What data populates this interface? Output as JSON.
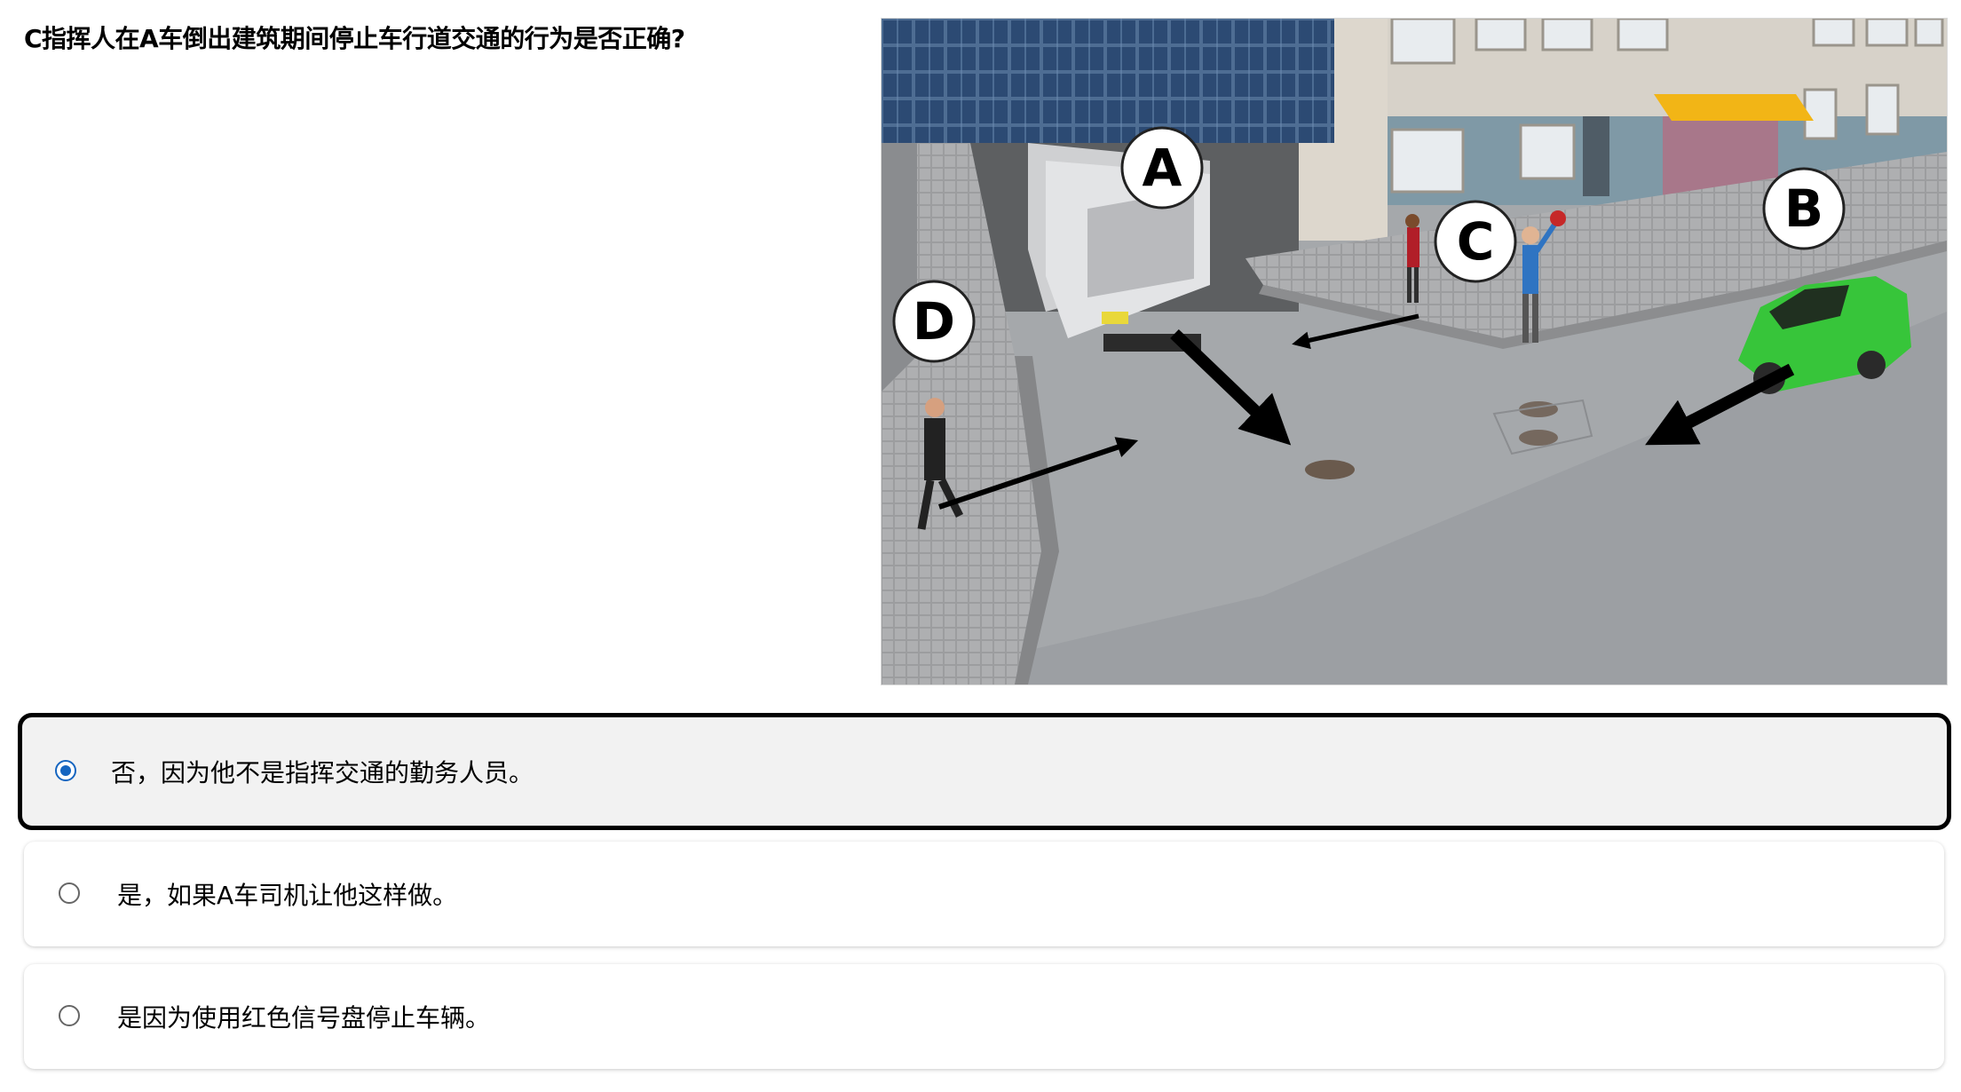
{
  "question": {
    "text": "C指挥人在A车倒出建筑期间停止车行道交通的行为是否正确?"
  },
  "illustration": {
    "markers": [
      "A",
      "B",
      "C",
      "D"
    ]
  },
  "answers": [
    {
      "label": "否，因为他不是指挥交通的勤务人员。",
      "selected": true
    },
    {
      "label": "是，如果A车司机让他这样做。",
      "selected": false
    },
    {
      "label": "是因为使用红色信号盘停止车辆。",
      "selected": false
    }
  ],
  "colors": {
    "selected_border": "#000000",
    "selected_background": "#f2f2f2",
    "radio_accent": "#1565c0"
  }
}
